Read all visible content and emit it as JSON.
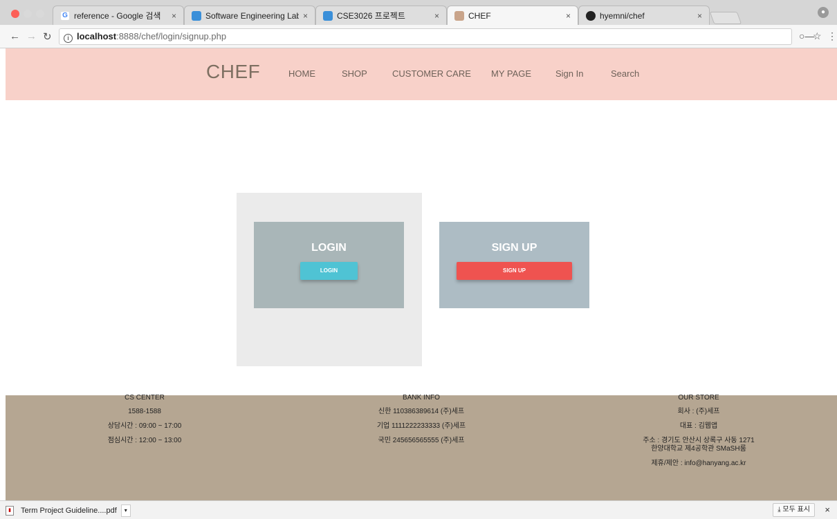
{
  "browser": {
    "tabs": [
      {
        "title": "reference - Google 검색",
        "favicon": "google-icon"
      },
      {
        "title": "Software Engineering Lab - Co",
        "favicon": "lab-icon"
      },
      {
        "title": "CSE3026 프로젝트",
        "favicon": "doc-icon"
      },
      {
        "title": "CHEF",
        "favicon": "chef-icon",
        "active": true
      },
      {
        "title": "hyemni/chef",
        "favicon": "github-icon"
      }
    ],
    "tab_close": "×",
    "url_host": "localhost",
    "url_rest": ":8888/chef/login/signup.php"
  },
  "header": {
    "brand": "CHEF",
    "menu": [
      "HOME",
      "SHOP",
      "CUSTOMER CARE",
      "MY PAGE",
      "Sign In",
      "Search"
    ]
  },
  "main": {
    "login": {
      "title": "LOGIN",
      "button": "LOGIN"
    },
    "signup": {
      "title": "SIGN UP",
      "button": "SIGN UP"
    }
  },
  "footer": {
    "cs": {
      "heading": "CS CENTER",
      "lines": [
        "1588-1588",
        "상담시간 : 09:00 ~ 17:00",
        "점심시간 : 12:00 ~ 13:00"
      ]
    },
    "bank": {
      "heading": "BANK INFO",
      "lines": [
        "신한 110386389614 (주)세프",
        "기업 1111222233333 (주)세프",
        "국민 245656565555 (주)세프"
      ]
    },
    "store": {
      "heading": "OUR STORE",
      "lines": [
        "회사 : (주)세프",
        "대표 : 김웹앱",
        "주소 : 경기도 안산시 상록구 사동 1271",
        "한양대학교 제4공학관 SMaSH룸",
        "제휴/제안 : info@hanyang.ac.kr"
      ]
    }
  },
  "downloads": {
    "file": "Term Project Guideline....pdf",
    "show_all": "모두 표시",
    "close": "×"
  },
  "colors": {
    "header_bg": "#f8d1c9",
    "footer_bg": "#b5a692",
    "login_card": "#a9b6b8",
    "signup_card": "#adbcc4",
    "login_button": "#4fc3d4",
    "signup_button": "#ef5350"
  }
}
